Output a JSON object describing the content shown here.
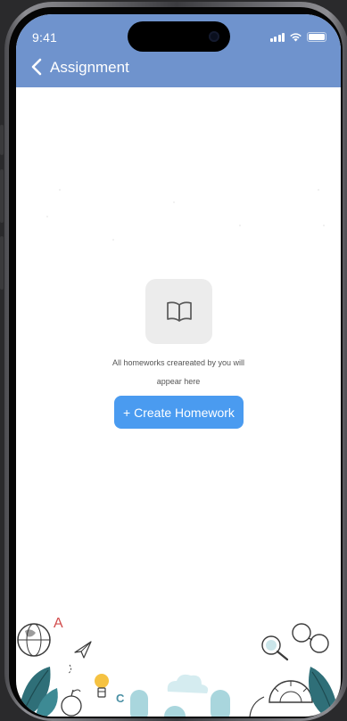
{
  "status_bar": {
    "time": "9:41"
  },
  "header": {
    "title": "Assignment",
    "back_icon": "chevron-left-icon"
  },
  "empty_state": {
    "icon": "open-book-icon",
    "message_line1": "All homeworks creareated by you will",
    "message_line2": "appear here"
  },
  "actions": {
    "create_label": "+ Create Homework"
  },
  "decoration": {
    "letter_a": "A",
    "letter_c": "C"
  },
  "colors": {
    "header": "#6f93cd",
    "primary_button": "#4a9bf0",
    "icon_box": "#ececec",
    "background": "#ffffff"
  }
}
